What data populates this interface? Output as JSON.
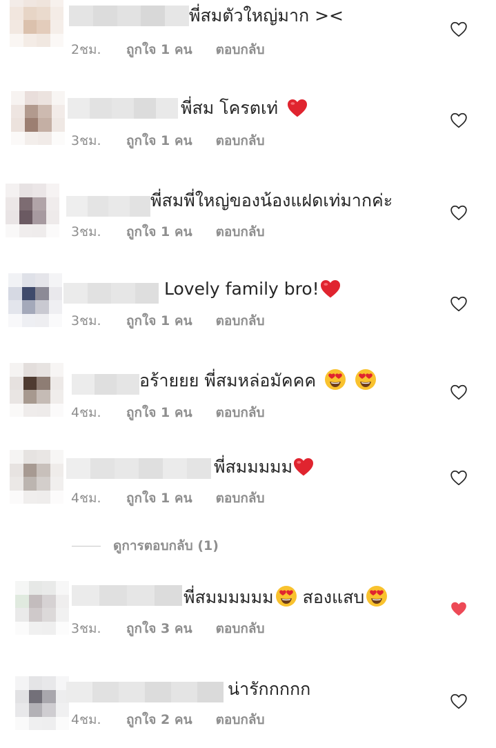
{
  "colors": {
    "meta_gray": "#8e8e8e",
    "like_red": "#ed4956",
    "outline_gray": "#262626"
  },
  "comments": [
    {
      "text": "พี่สมตัวใหญ่มาก ><",
      "time": "2ชม.",
      "likes": "ถูกใจ 1 คน",
      "reply": "ตอบกลับ",
      "liked": false,
      "icons": []
    },
    {
      "text": "พี่สม โครตเท่",
      "time": "3ชม.",
      "likes": "ถูกใจ 1 คน",
      "reply": "ตอบกลับ",
      "liked": false,
      "icons": [
        "red-heart-emoji-icon"
      ]
    },
    {
      "text": "พี่สมพี่ใหญ่ของน้องแฝดเท่มากค่ะ",
      "time": "3ชม.",
      "likes": "ถูกใจ 1 คน",
      "reply": "ตอบกลับ",
      "liked": false,
      "icons": []
    },
    {
      "text": "Lovely family bro!",
      "time": "3ชม.",
      "likes": "ถูกใจ 1 คน",
      "reply": "ตอบกลับ",
      "liked": false,
      "icons": [
        "red-heart-emoji-icon"
      ]
    },
    {
      "text": "อร้ายยย พี่สมหล่อมัคคค",
      "time": "4ชม.",
      "likes": "ถูกใจ 1 คน",
      "reply": "ตอบกลับ",
      "liked": false,
      "icons": [
        "heart-eyes-emoji-icon",
        "heart-eyes-emoji-icon"
      ]
    },
    {
      "text": "พี่สมมมมม",
      "time": "4ชม.",
      "likes": "ถูกใจ 1 คน",
      "reply": "ตอบกลับ",
      "liked": false,
      "icons": [
        "red-heart-emoji-icon"
      ]
    },
    {
      "text": "พี่สมมมมมม",
      "text2": "สองแสบ",
      "time": "3ชม.",
      "likes": "ถูกใจ 3 คน",
      "reply": "ตอบกลับ",
      "liked": true,
      "icons": [
        "heart-eyes-emoji-icon",
        "heart-eyes-emoji-icon"
      ]
    },
    {
      "text": "น่ารักกกกก",
      "time": "4ชม.",
      "likes": "ถูกใจ 2 คน",
      "reply": "ตอบกลับ",
      "liked": false,
      "icons": []
    }
  ],
  "view_replies": "ดูการตอบกลับ (1)"
}
